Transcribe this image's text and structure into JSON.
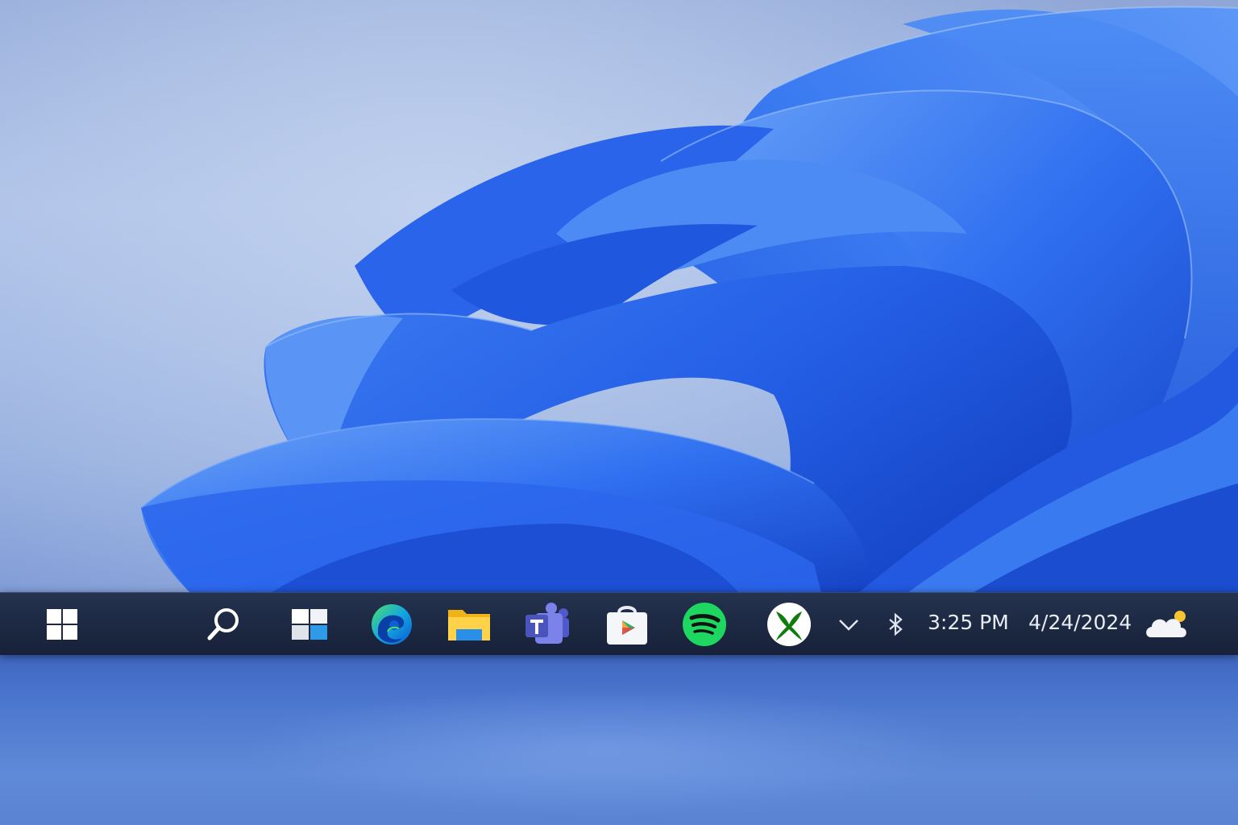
{
  "desktop": {
    "wallpaper": "windows-11-bloom",
    "colors": {
      "bloom_primary": "#2f6ff0",
      "bloom_dark": "#1747c9",
      "bloom_light": "#5a97f5",
      "background": "#a8bde6",
      "taskbar": "#1c2740"
    }
  },
  "taskbar": {
    "start": {
      "icon": "windows-logo-icon"
    },
    "pinned": [
      {
        "name": "Search",
        "icon": "search-icon"
      },
      {
        "name": "Widgets",
        "icon": "widgets-icon"
      },
      {
        "name": "Microsoft Edge",
        "icon": "edge-icon"
      },
      {
        "name": "File Explorer",
        "icon": "folder-icon"
      },
      {
        "name": "Microsoft Teams",
        "icon": "teams-icon"
      },
      {
        "name": "Microsoft Store",
        "icon": "store-icon"
      },
      {
        "name": "Spotify",
        "icon": "spotify-icon"
      },
      {
        "name": "Xbox",
        "icon": "xbox-icon"
      }
    ],
    "tray": {
      "overflow_icon": "chevron-up-icon",
      "bluetooth_icon": "bluetooth-icon",
      "time": "3:25 PM",
      "date": "4/24/2024",
      "weather_icon": "partly-cloudy-icon"
    }
  }
}
